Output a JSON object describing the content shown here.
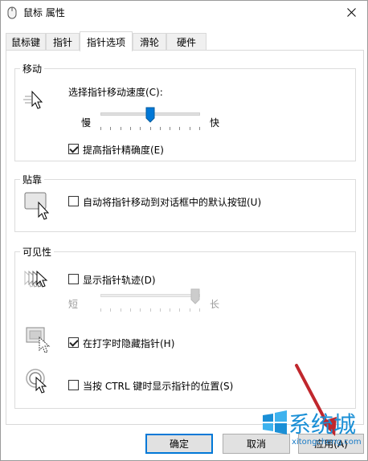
{
  "window": {
    "title": "鼠标 属性"
  },
  "tabs": [
    {
      "label": "鼠标键"
    },
    {
      "label": "指针"
    },
    {
      "label": "指针选项"
    },
    {
      "label": "滑轮"
    },
    {
      "label": "硬件"
    }
  ],
  "motion": {
    "title": "移动",
    "speed_label": "选择指针移动速度(C):",
    "slow_label": "慢",
    "fast_label": "快",
    "speed_value_fraction": 0.5,
    "precision_label": "提高指针精确度(E)",
    "precision_checked": true
  },
  "snap": {
    "title": "贴靠",
    "snap_label": "自动将指针移动到对话框中的默认按钮(U)",
    "snap_checked": false
  },
  "visibility": {
    "title": "可见性",
    "trails_label": "显示指针轨迹(D)",
    "trails_checked": false,
    "short_label": "短",
    "long_label": "长",
    "trails_value_fraction": 1.0,
    "hide_label": "在打字时隐藏指针(H)",
    "hide_checked": true,
    "ctrl_label": "当按 CTRL 键时显示指针的位置(S)",
    "ctrl_checked": false
  },
  "buttons": {
    "ok": "确定",
    "cancel": "取消",
    "apply": "应用(A)"
  },
  "watermark": {
    "main": "系统城",
    "sub": "xitongcheng.com"
  },
  "colors": {
    "accent": "#0078d7",
    "watermark": "#1a8fd6",
    "arrow": "#c0272d"
  }
}
